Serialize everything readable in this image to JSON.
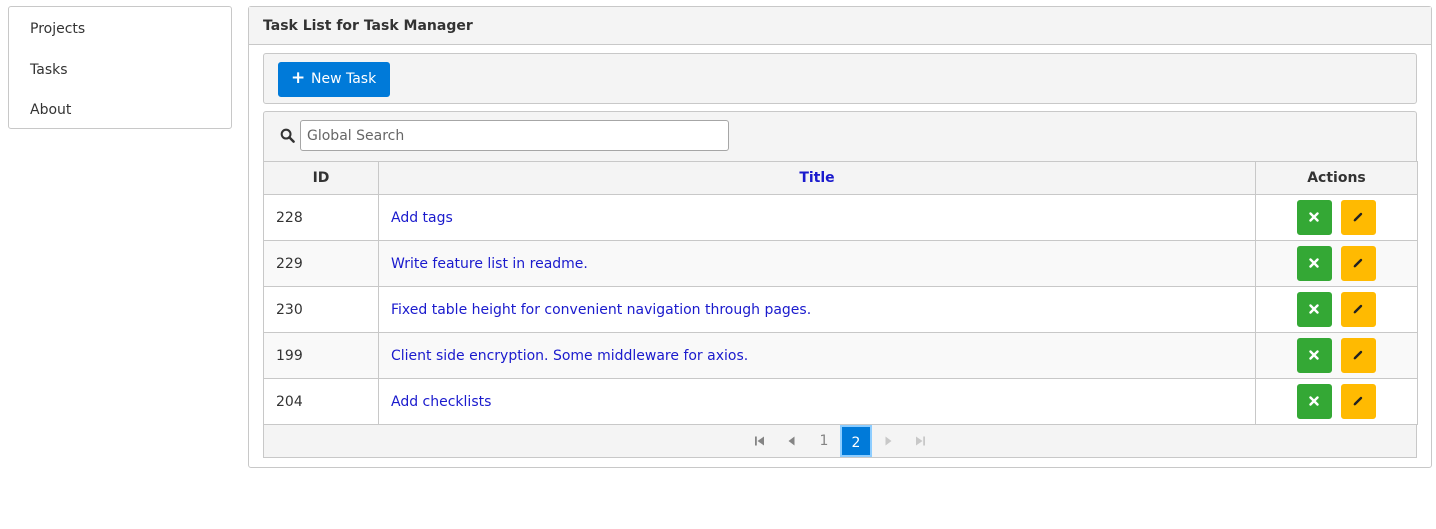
{
  "sidebar": {
    "items": [
      {
        "label": "Projects"
      },
      {
        "label": "Tasks"
      },
      {
        "label": "About"
      }
    ]
  },
  "panel": {
    "title": "Task List for Task Manager"
  },
  "toolbar": {
    "new_task_label": "New Task",
    "new_task_icon": "plus-icon"
  },
  "search": {
    "placeholder": "Global Search",
    "value": "",
    "icon": "search-icon"
  },
  "table": {
    "columns": [
      {
        "label": "ID"
      },
      {
        "label": "Title",
        "sortable": true
      },
      {
        "label": "Actions"
      }
    ],
    "rows": [
      {
        "id": "228",
        "title": "Add tags"
      },
      {
        "id": "229",
        "title": "Write feature list in readme."
      },
      {
        "id": "230",
        "title": "Fixed table height for convenient navigation through pages."
      },
      {
        "id": "199",
        "title": "Client side encryption. Some middleware for axios."
      },
      {
        "id": "204",
        "title": "Add checklists"
      }
    ],
    "row_actions": [
      {
        "name": "delete",
        "icon": "close-icon",
        "color": "#34a835"
      },
      {
        "name": "edit",
        "icon": "pencil-icon",
        "color": "#ffba01"
      }
    ]
  },
  "paginator": {
    "pages": [
      "1",
      "2"
    ],
    "current_page": "2",
    "first_icon": "first-page-icon",
    "prev_icon": "prev-page-icon",
    "next_icon": "next-page-icon",
    "last_icon": "last-page-icon"
  },
  "colors": {
    "primary": "#007ad9",
    "success": "#34a835",
    "warning": "#ffba01",
    "link": "#1a1acd"
  }
}
